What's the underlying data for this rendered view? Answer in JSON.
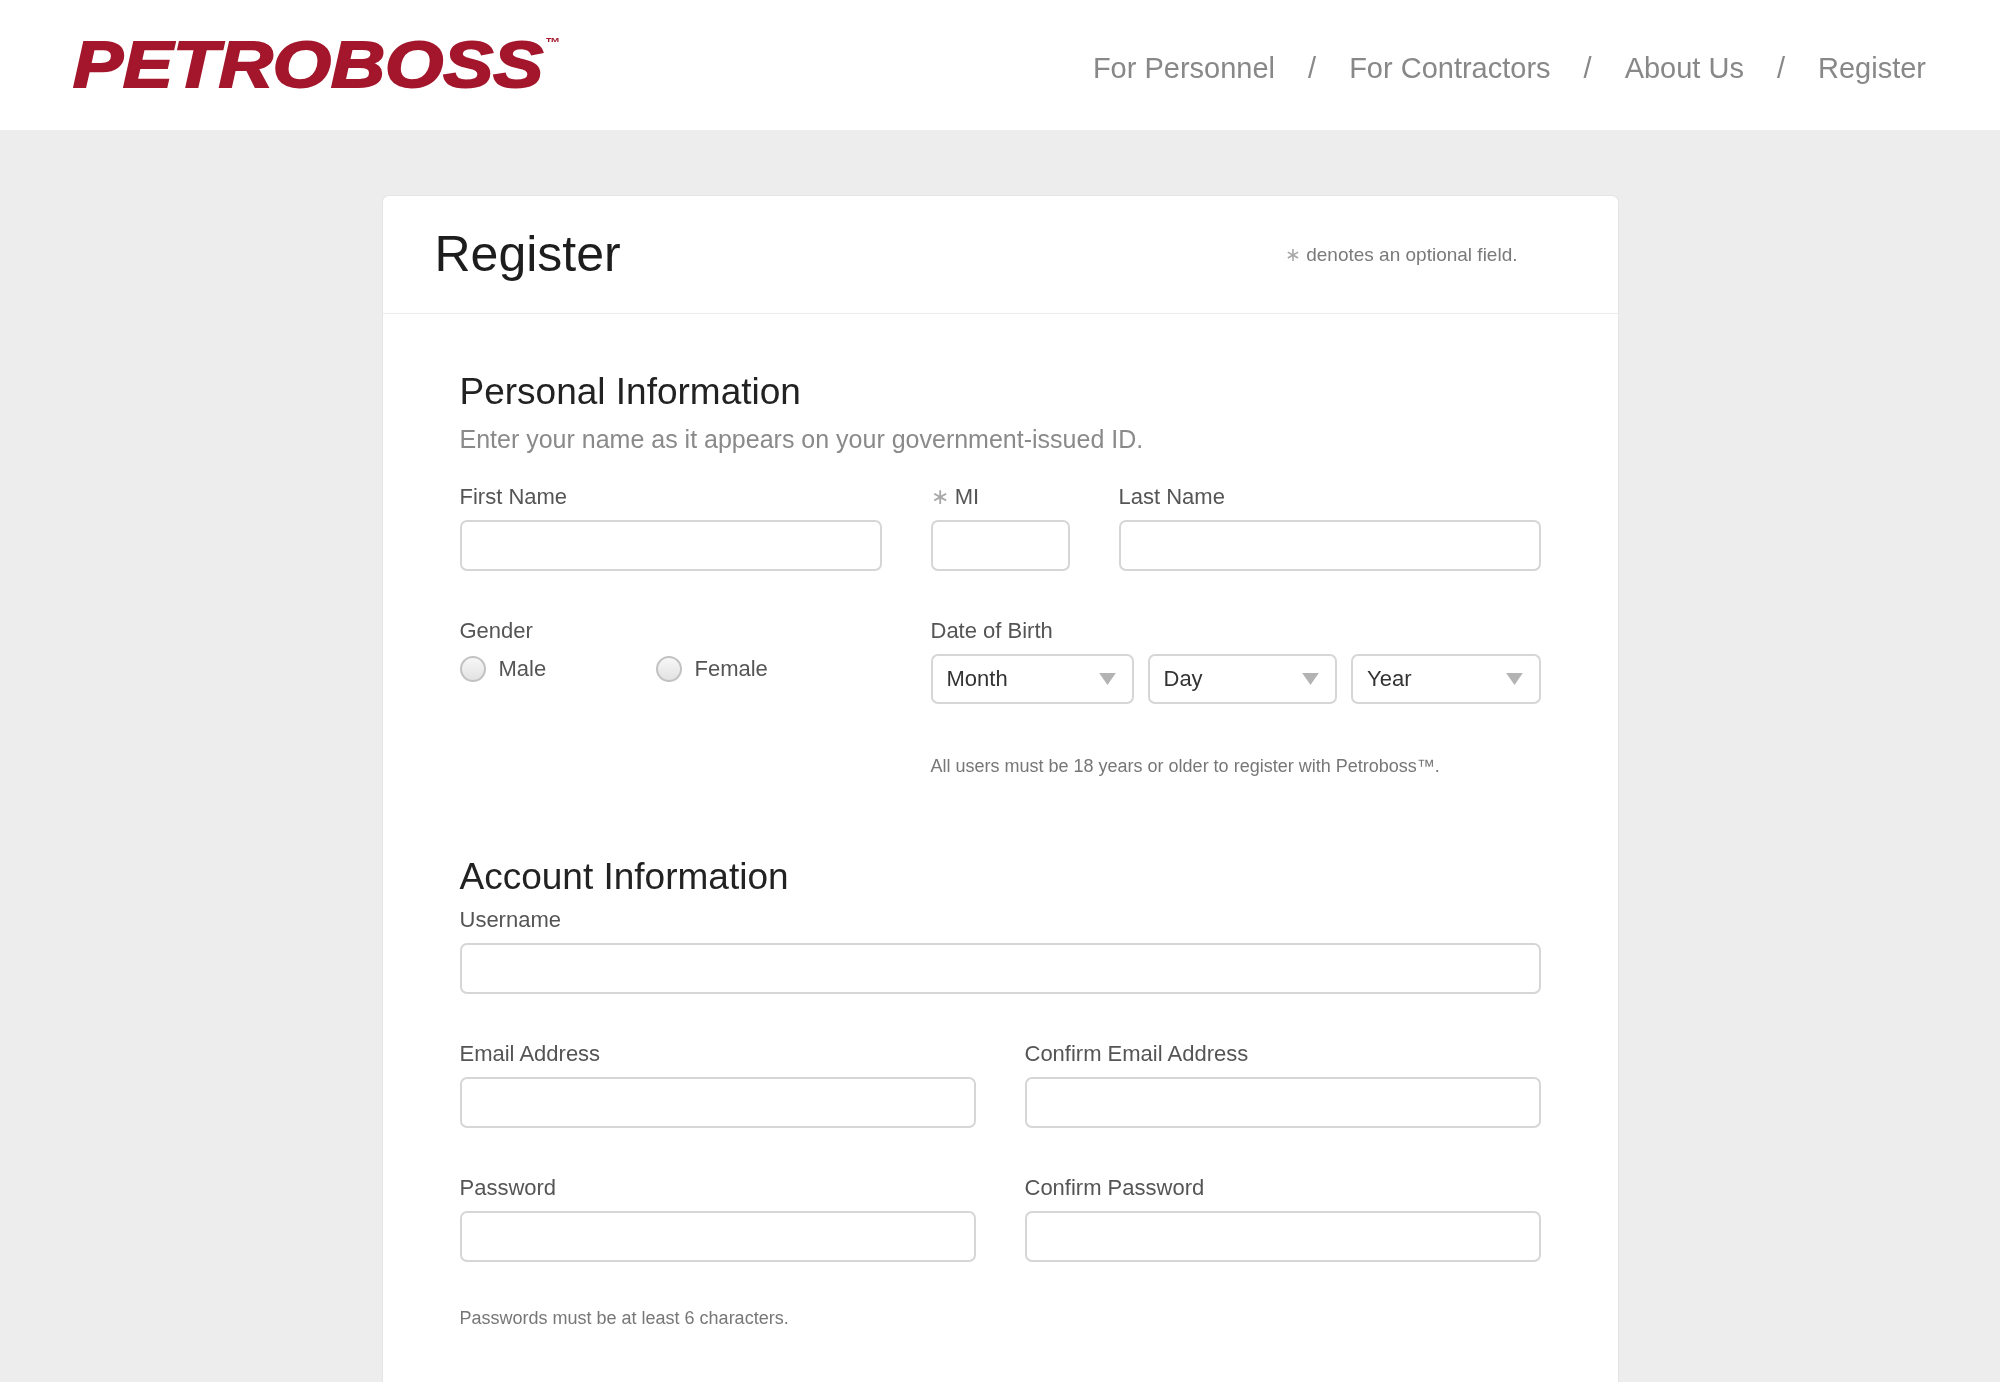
{
  "header": {
    "logo": "PETROBOSS$^{™}$",
    "nav": {
      "links": [
        {
          "label": "For Personnel"
        },
        {
          "label": "For Contractors"
        },
        {
          "label": "About Us"
        },
        {
          "label": "Register"
        }
      ],
      "separators": [
        "/",
        "/",
        "/"
      ]
    }
  },
  "card": {
    "title": "Register",
    "legend": {
      "marker": "∗",
      "text": "denotes an optional field."
    }
  },
  "personal_information": {
    "heading": "Personal Information",
    "subtitle": "Enter your name as it appears on your government-issued ID.",
    "name_fields": [
      {
        "label": "First Name"
      },
      {
        "label": "MI",
        "optional_marker": "∗"
      },
      {
        "label": "Last Name"
      }
    ],
    "gender": {
      "label": "Gender",
      "options": [
        {
          "label": "Male",
          "selected": false
        },
        {
          "label": "Female",
          "selected": false
        }
      ]
    },
    "date_of_birth": {
      "label": "Date of Birth",
      "selects": [
        {
          "value": "Month"
        },
        {
          "value": "Day"
        },
        {
          "value": "Year"
        }
      ],
      "note": "All users must be 18 years or older to register with Petroboss™."
    }
  },
  "account_information": {
    "heading": "Account Information",
    "rows": [
      [
        {
          "label": "Username"
        }
      ],
      [
        {
          "label": "Email Address"
        },
        {
          "label": "Confirm Email Address"
        }
      ],
      [
        {
          "label": "Password"
        },
        {
          "label": "Confirm Password"
        }
      ]
    ],
    "note": "Passwords must be at least 6 characters."
  }
}
